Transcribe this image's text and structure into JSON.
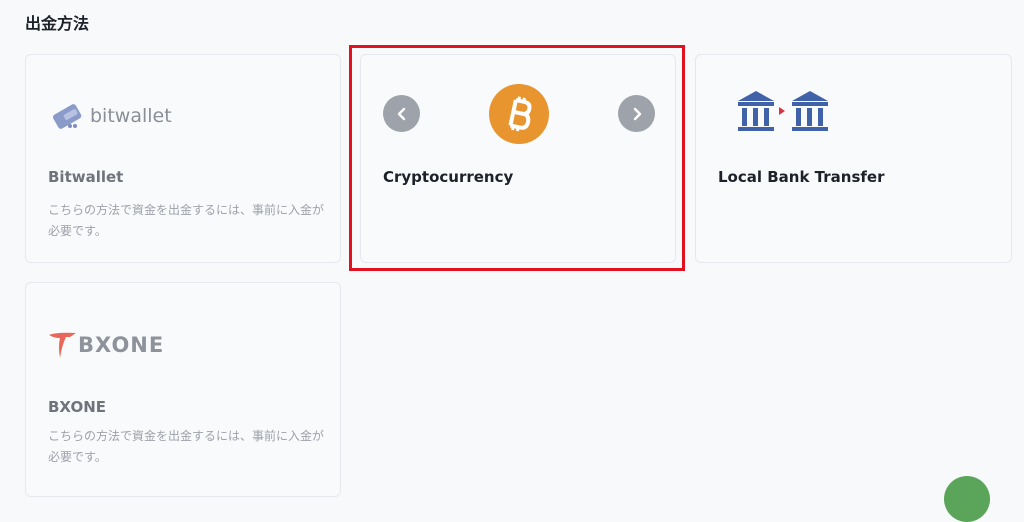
{
  "page": {
    "title": "出金方法"
  },
  "methods": [
    {
      "logo_text": "bitwallet",
      "title": "Bitwallet",
      "description": "こちらの方法で資金を出金するには、事前に入金が必要です。",
      "icon": "bitwallet-logo"
    },
    {
      "title": "Cryptocurrency",
      "icon": "bitcoin-icon"
    },
    {
      "title": "Local Bank Transfer",
      "icon": "bank-transfer-icon"
    },
    {
      "logo_text": "BXONE",
      "title": "BXONE",
      "description": "こちらの方法で資金を出金するには、事前に入金が必要です。",
      "icon": "bxone-logo"
    }
  ],
  "colors": {
    "bitcoin": "#e8952f",
    "bank": "#3f62a8",
    "highlight": "#e1111f",
    "bxone_red": "#e8675a",
    "chat": "#5ba55a"
  }
}
